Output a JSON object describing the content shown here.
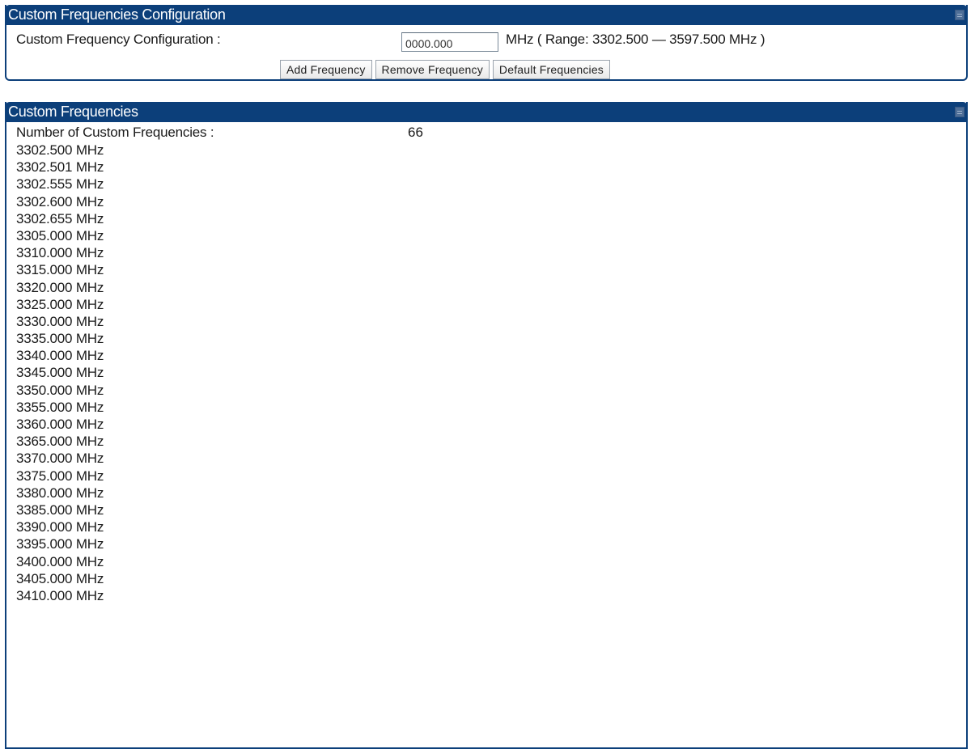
{
  "config_panel": {
    "title": "Custom Frequencies Configuration",
    "field_label": "Custom Frequency Configuration :",
    "input_value": "0000.000",
    "range_text": "MHz ( Range: 3302.500 — 3597.500 MHz )",
    "buttons": {
      "add": "Add Frequency",
      "remove": "Remove Frequency",
      "default": "Default Frequencies"
    }
  },
  "freqs_panel": {
    "title": "Custom Frequencies",
    "count_label": "Number of Custom Frequencies :",
    "count_value": "66",
    "frequencies": [
      "3302.500 MHz",
      "3302.501 MHz",
      "3302.555 MHz",
      "3302.600 MHz",
      "3302.655 MHz",
      "3305.000 MHz",
      "3310.000 MHz",
      "3315.000 MHz",
      "3320.000 MHz",
      "3325.000 MHz",
      "3330.000 MHz",
      "3335.000 MHz",
      "3340.000 MHz",
      "3345.000 MHz",
      "3350.000 MHz",
      "3355.000 MHz",
      "3360.000 MHz",
      "3365.000 MHz",
      "3370.000 MHz",
      "3375.000 MHz",
      "3380.000 MHz",
      "3385.000 MHz",
      "3390.000 MHz",
      "3395.000 MHz",
      "3400.000 MHz",
      "3405.000 MHz",
      "3410.000 MHz"
    ]
  },
  "colors": {
    "header_bg": "#0c3f7a",
    "header_text": "#ffffff"
  }
}
